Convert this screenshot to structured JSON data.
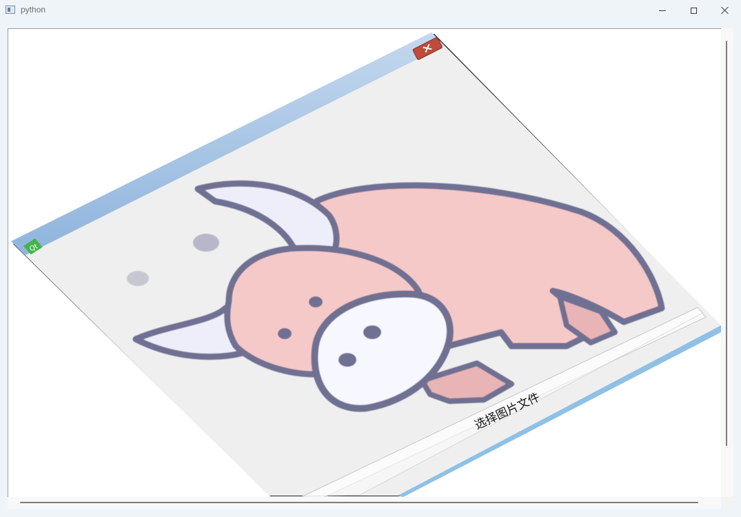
{
  "window": {
    "title": "python",
    "icon": "window-app-icon"
  },
  "controls": {
    "minimize_icon": "minimize-icon",
    "maximize_icon": "maximize-icon",
    "close_icon": "close-icon"
  },
  "inner_window": {
    "app_icon": "qt-logo-icon",
    "close_icon": "close-icon",
    "image": "cartoon-bull",
    "button_label": "选择图片文件"
  },
  "colors": {
    "bull_body": "#f6c9c9",
    "bull_outline": "#6f6f92",
    "horn": "#eeeefb",
    "title_gradient_top": "#c4d8ee",
    "title_gradient_bottom": "#8fb4dd",
    "close_red": "#c04b3b",
    "qt_green": "#41b649"
  }
}
